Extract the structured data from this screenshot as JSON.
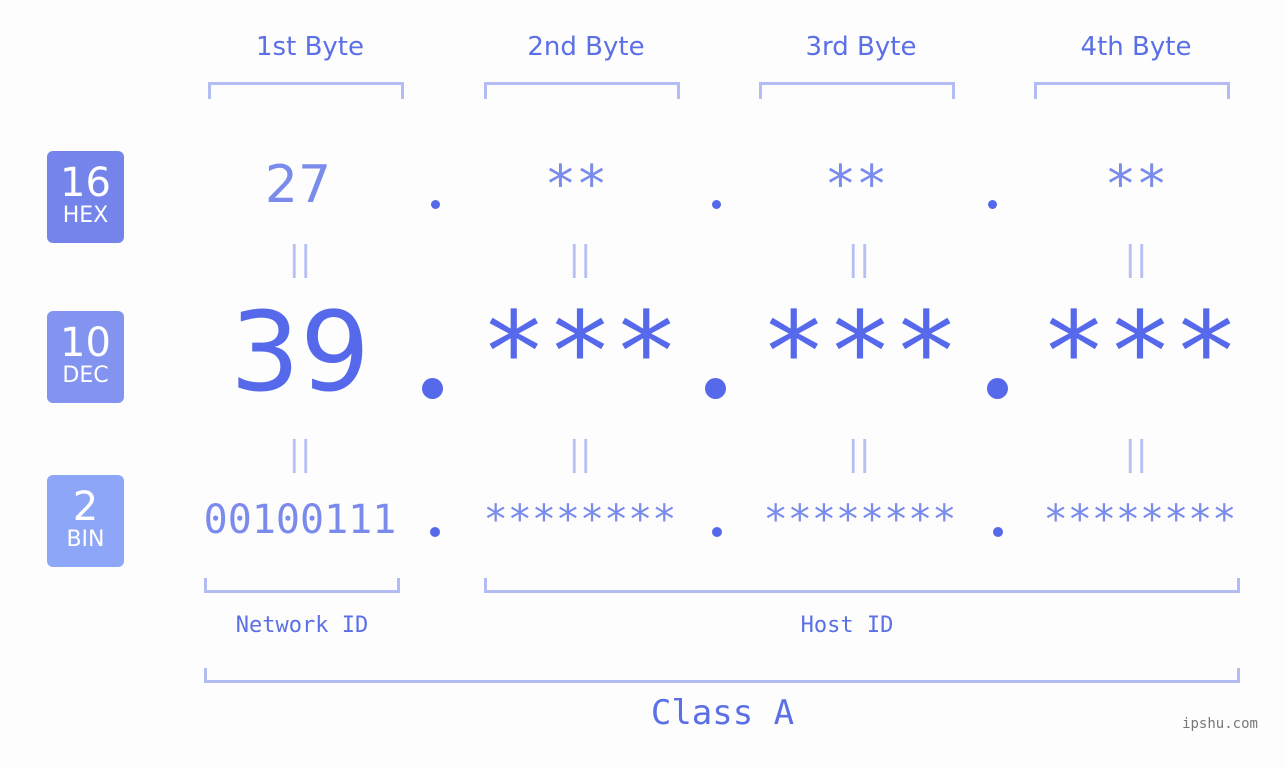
{
  "bytes": [
    {
      "title": "1st Byte",
      "hex": "27",
      "dec": "39",
      "bin": "00100111"
    },
    {
      "title": "2nd Byte",
      "hex": "**",
      "dec": "***",
      "bin": "********"
    },
    {
      "title": "3rd Byte",
      "hex": "**",
      "dec": "***",
      "bin": "********"
    },
    {
      "title": "4th Byte",
      "hex": "**",
      "dec": "***",
      "bin": "********"
    }
  ],
  "badges": {
    "hex": {
      "num": "16",
      "label": "HEX",
      "color": "#7584ea"
    },
    "dec": {
      "num": "10",
      "label": "DEC",
      "color": "#8393f0"
    },
    "bin": {
      "num": "2",
      "label": "BIN",
      "color": "#8ea6f7"
    }
  },
  "equals_sign": "||",
  "labels": {
    "network_id": "Network ID",
    "host_id": "Host ID",
    "class": "Class A"
  },
  "watermark": "ipshu.com",
  "colors": {
    "accent": "#5569ea",
    "light_accent": "#7b8bec",
    "bracket": "#b3bcf5"
  }
}
